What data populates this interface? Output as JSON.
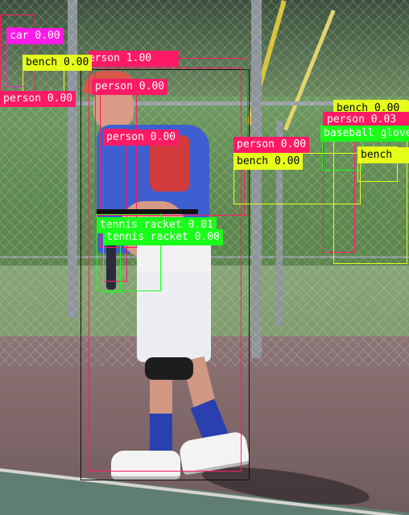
{
  "labels": {
    "car": "car 0.00",
    "bench_a": "bench 0.00",
    "person_a": "person 1.00",
    "person_b": "person 0.00",
    "person_c": "person 0.00",
    "person_d": "person 0.00",
    "person_e": "person 0.00",
    "person_f": "person 0.03",
    "bench_b": "bench 0.00",
    "bench_c": "bench 0.00",
    "bench_d": "bench",
    "glove": "baseball glove",
    "racket_a": "tennis racket 0.01",
    "racket_b": "tennis racket 0.00"
  },
  "colors": {
    "person": "#ff1a66",
    "bench": "#e6ff1a",
    "car": "#ff1ae6",
    "glove": "#1aff1a",
    "racket": "#1aff1a",
    "label_text_dark": "#000000",
    "label_text_light": "#ffffff",
    "main_box": "#111111"
  }
}
